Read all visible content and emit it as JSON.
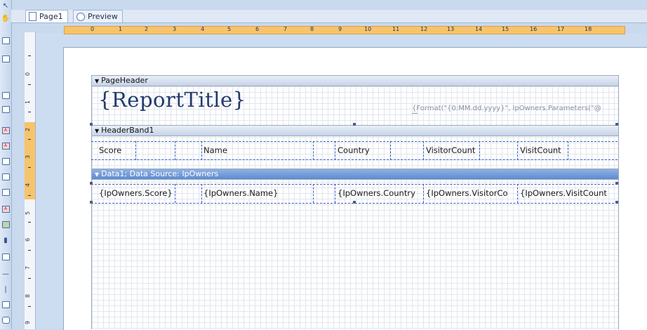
{
  "tabs": [
    {
      "label": "Page1"
    },
    {
      "label": "Preview"
    }
  ],
  "icons": {
    "pointer": "pointer-icon",
    "hand": "hand-icon",
    "page_tab": "page-icon",
    "preview_tab": "preview-icon"
  },
  "hruler": {
    "labels": [
      "0",
      "1",
      "2",
      "3",
      "4",
      "5",
      "6",
      "7",
      "8",
      "9",
      "10",
      "11",
      "12",
      "13",
      "14",
      "15",
      "16",
      "17",
      "18"
    ]
  },
  "vruler": {
    "labels": [
      "0",
      "1",
      "2",
      "3",
      "4",
      "5",
      "6",
      "7",
      "8",
      "9"
    ]
  },
  "report": {
    "page_header": {
      "band_label": "PageHeader",
      "title": "{ReportTitle}",
      "date_expr": "{Format(\"{0:MM.dd.yyyy}\", IpOwners.Parameters(\"@"
    },
    "header_band": {
      "band_label": "HeaderBand1",
      "columns": [
        "Score",
        "Name",
        "Country",
        "VisitorCount",
        "VisitCount"
      ]
    },
    "data_band": {
      "band_label": "Data1; Data Source: IpOwners",
      "fields": [
        "{IpOwners.Score}",
        "{IpOwners.Name}",
        "{IpOwners.Country",
        "{IpOwners.VisitorCo",
        "{IpOwners.VisitCount"
      ]
    }
  },
  "colors": {
    "accent": "#5f8bd0",
    "ruler": "#f6c46a",
    "toolbox": "#dfe9f6"
  }
}
